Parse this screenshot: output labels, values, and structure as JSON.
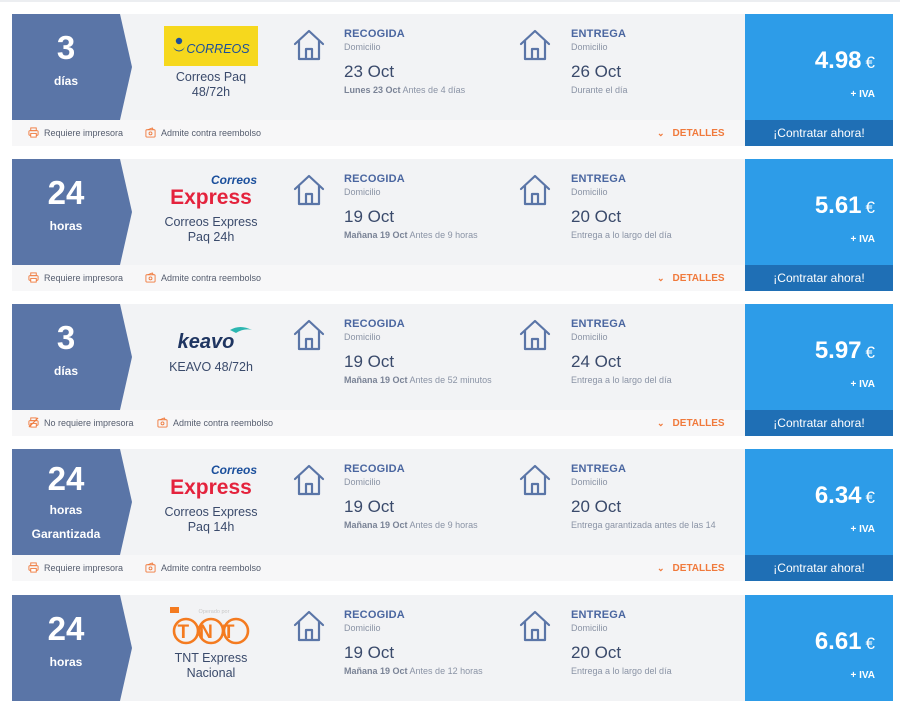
{
  "labels": {
    "pickup_title": "RECOGIDA",
    "pickup_sub": "Domicilio",
    "delivery_title": "ENTREGA",
    "delivery_sub": "Domicilio",
    "details": "DETALLES",
    "cta": "¡Contratar ahora!",
    "vat": "+ IVA",
    "currency": "€",
    "cash_on_delivery": "Admite contra reembolso"
  },
  "icons": [
    "house-icon",
    "printer-icon",
    "no-printer-icon",
    "wallet-icon",
    "chevron-down-icon"
  ],
  "colors": {
    "days_block": "#5a75a7",
    "price_block": "#2d9ce8",
    "cta": "#1f6fb5",
    "details": "#f07a3c",
    "correos_yellow": "#f6d81d",
    "express_red": "#e4233d",
    "correos_blue": "#1b4f9c",
    "tnt_orange": "#f47b20",
    "keavo_navy": "#1f3561",
    "keavo_teal": "#2cb6b0"
  },
  "offers": [
    {
      "days_num": "3",
      "days_unit": "días",
      "days_extra": "",
      "logo": "correos",
      "logo_text": "CORREOS",
      "carrier": "Correos Paq\n48/72h",
      "pickup_date": "23 Oct",
      "pickup_note_bold": "Lunes 23 Oct",
      "pickup_note": "Antes de 4 días",
      "delivery_date": "26 Oct",
      "delivery_note": "Durante el día",
      "price": "4.98",
      "printer": "Requiere impresora",
      "printer_icon": "printer-icon"
    },
    {
      "days_num": "24",
      "days_unit": "horas",
      "days_extra": "",
      "logo": "correos-express",
      "logo_text": "Correos",
      "logo_text2": "Express",
      "carrier": "Correos Express\nPaq 24h",
      "pickup_date": "19 Oct",
      "pickup_note_bold": "Mañana 19 Oct",
      "pickup_note": "Antes de 9 horas",
      "delivery_date": "20 Oct",
      "delivery_note": "Entrega a lo largo del día",
      "price": "5.61",
      "printer": "Requiere impresora",
      "printer_icon": "printer-icon"
    },
    {
      "days_num": "3",
      "days_unit": "días",
      "days_extra": "",
      "logo": "keavo",
      "logo_text": "keavo",
      "carrier": "KEAVO 48/72h",
      "pickup_date": "19 Oct",
      "pickup_note_bold": "Mañana 19 Oct",
      "pickup_note": "Antes de 52 minutos",
      "delivery_date": "24 Oct",
      "delivery_note": "Entrega a lo largo del día",
      "price": "5.97",
      "printer": "No requiere impresora",
      "printer_icon": "no-printer-icon"
    },
    {
      "days_num": "24",
      "days_unit": "horas",
      "days_extra": "Garantizada",
      "logo": "correos-express",
      "logo_text": "Correos",
      "logo_text2": "Express",
      "carrier": "Correos Express\nPaq 14h",
      "pickup_date": "19 Oct",
      "pickup_note_bold": "Mañana 19 Oct",
      "pickup_note": "Antes de 9 horas",
      "delivery_date": "20 Oct",
      "delivery_note": "Entrega garantizada antes de las 14",
      "price": "6.34",
      "printer": "Requiere impresora",
      "printer_icon": "printer-icon"
    },
    {
      "days_num": "24",
      "days_unit": "horas",
      "days_extra": "",
      "logo": "tnt",
      "logo_text": "TNT",
      "logo_tag": "Operado por",
      "carrier": "TNT Express\nNacional",
      "pickup_date": "19 Oct",
      "pickup_note_bold": "Mañana 19 Oct",
      "pickup_note": "Antes de 12 horas",
      "delivery_date": "20 Oct",
      "delivery_note": "Entrega a lo largo del día",
      "price": "6.61",
      "printer": "",
      "printer_icon": ""
    }
  ]
}
